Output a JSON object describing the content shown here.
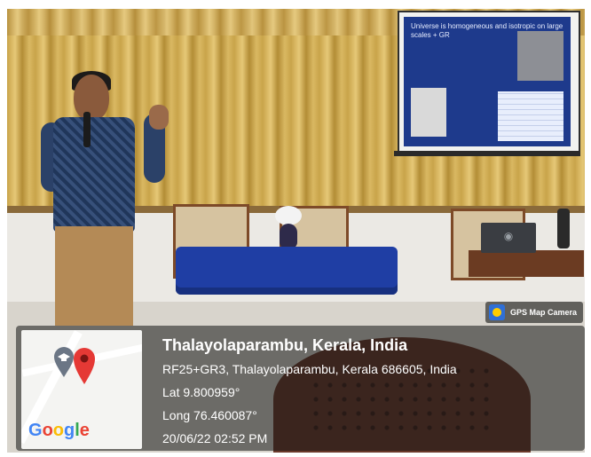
{
  "photo": {
    "slide_title": "Universe is homogeneous and isotropic on large scales + GR"
  },
  "badge": {
    "label": "GPS Map Camera",
    "icon": "gps-map-camera-icon"
  },
  "map": {
    "brand_letters": [
      "G",
      "o",
      "o",
      "g",
      "l",
      "e"
    ],
    "brand_colors": [
      "#4285F4",
      "#EA4335",
      "#FBBC05",
      "#4285F4",
      "#34A853",
      "#EA4335"
    ],
    "pin_red_color": "#e53935",
    "pin_grey_color": "#6b7685"
  },
  "location": {
    "place": "Thalayolaparambu, Kerala, India",
    "address": "RF25+GR3, Thalayolaparambu, Kerala 686605, India",
    "lat": "Lat 9.800959°",
    "long": "Long 76.460087°",
    "datetime": "20/06/22 02:52 PM"
  },
  "colors": {
    "overlay": "rgba(20,20,20,0.55)",
    "curtain": "#c9a44a",
    "tablecloth": "#1f3ea4",
    "slide_bg": "#1e3a8c"
  }
}
